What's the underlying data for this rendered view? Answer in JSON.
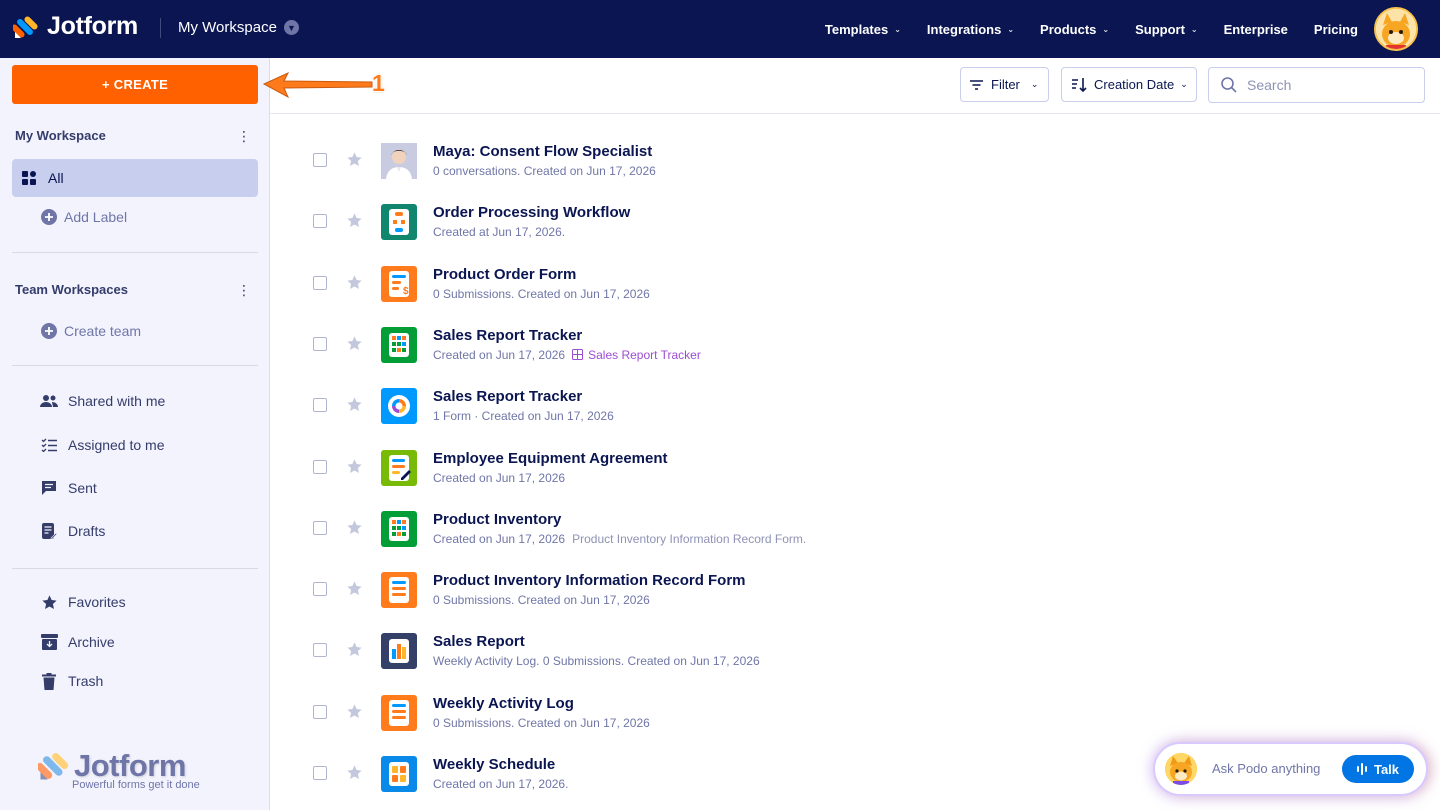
{
  "header": {
    "brand": "Jotform",
    "workspace_label": "My Workspace",
    "nav": [
      {
        "label": "Templates",
        "dropdown": true
      },
      {
        "label": "Integrations",
        "dropdown": true
      },
      {
        "label": "Products",
        "dropdown": true
      },
      {
        "label": "Support",
        "dropdown": true
      },
      {
        "label": "Enterprise",
        "dropdown": false
      },
      {
        "label": "Pricing",
        "dropdown": false
      }
    ]
  },
  "sidebar": {
    "create_label": "+ CREATE",
    "my_workspace_title": "My Workspace",
    "all_label": "All",
    "add_label": "Add Label",
    "team_workspaces_title": "Team Workspaces",
    "create_team_label": "Create team",
    "shared_label": "Shared with me",
    "assigned_label": "Assigned to me",
    "sent_label": "Sent",
    "drafts_label": "Drafts",
    "favorites_label": "Favorites",
    "archive_label": "Archive",
    "trash_label": "Trash",
    "footer_brand": "Jotform",
    "footer_tagline": "Powerful forms get it done"
  },
  "annotation": {
    "number": "1"
  },
  "toolbar": {
    "filter_label": "Filter",
    "sort_label": "Creation Date",
    "search_placeholder": "Search"
  },
  "items": [
    {
      "title": "Maya: Consent Flow Specialist",
      "sub": "0 conversations. Created on Jun 17, 2026",
      "extra": "",
      "link": "",
      "icon": "agent-avatar-icon",
      "color": "#7a7fa8"
    },
    {
      "title": "Order Processing Workflow",
      "sub": "Created at Jun 17, 2026.",
      "extra": "",
      "link": "",
      "icon": "workflow-icon",
      "color": "#10866f"
    },
    {
      "title": "Product Order Form",
      "sub": "0 Submissions. Created on Jun 17, 2026",
      "extra": "",
      "link": "",
      "icon": "payment-form-icon",
      "color": "#ff7b1c"
    },
    {
      "title": "Sales Report Tracker",
      "sub": "Created on Jun 17, 2026",
      "extra": "",
      "link": "Sales Report Tracker",
      "icon": "table-icon",
      "color": "#049e38"
    },
    {
      "title": "Sales Report Tracker",
      "sub": "1 Form · Created on Jun 17, 2026",
      "extra": "",
      "link": "",
      "icon": "report-pie-icon",
      "color": "#0099ff"
    },
    {
      "title": "Employee Equipment Agreement",
      "sub": "Created on Jun 17, 2026",
      "extra": "",
      "link": "",
      "icon": "sign-document-icon",
      "color": "#78bb07"
    },
    {
      "title": "Product Inventory",
      "sub": "Created on Jun 17, 2026",
      "extra": "Product Inventory Information Record Form.",
      "link": "",
      "icon": "table-icon",
      "color": "#049e38"
    },
    {
      "title": "Product Inventory Information Record Form",
      "sub": "0 Submissions. Created on Jun 17, 2026",
      "extra": "",
      "link": "",
      "icon": "form-icon",
      "color": "#ff7b1c"
    },
    {
      "title": "Sales Report",
      "sub": "Weekly Activity Log. 0 Submissions. Created on Jun 17, 2026",
      "extra": "",
      "link": "",
      "icon": "bar-report-icon",
      "color": "#344067"
    },
    {
      "title": "Weekly Activity Log",
      "sub": "0 Submissions. Created on Jun 17, 2026",
      "extra": "",
      "link": "",
      "icon": "form-icon",
      "color": "#ff7b1c"
    },
    {
      "title": "Weekly Schedule",
      "sub": "Created on Jun 17, 2026.",
      "extra": "",
      "link": "",
      "icon": "app-icon",
      "color": "#0a8ae8"
    }
  ],
  "podo": {
    "prompt": "Ask Podo anything",
    "talk_label": "Talk"
  }
}
